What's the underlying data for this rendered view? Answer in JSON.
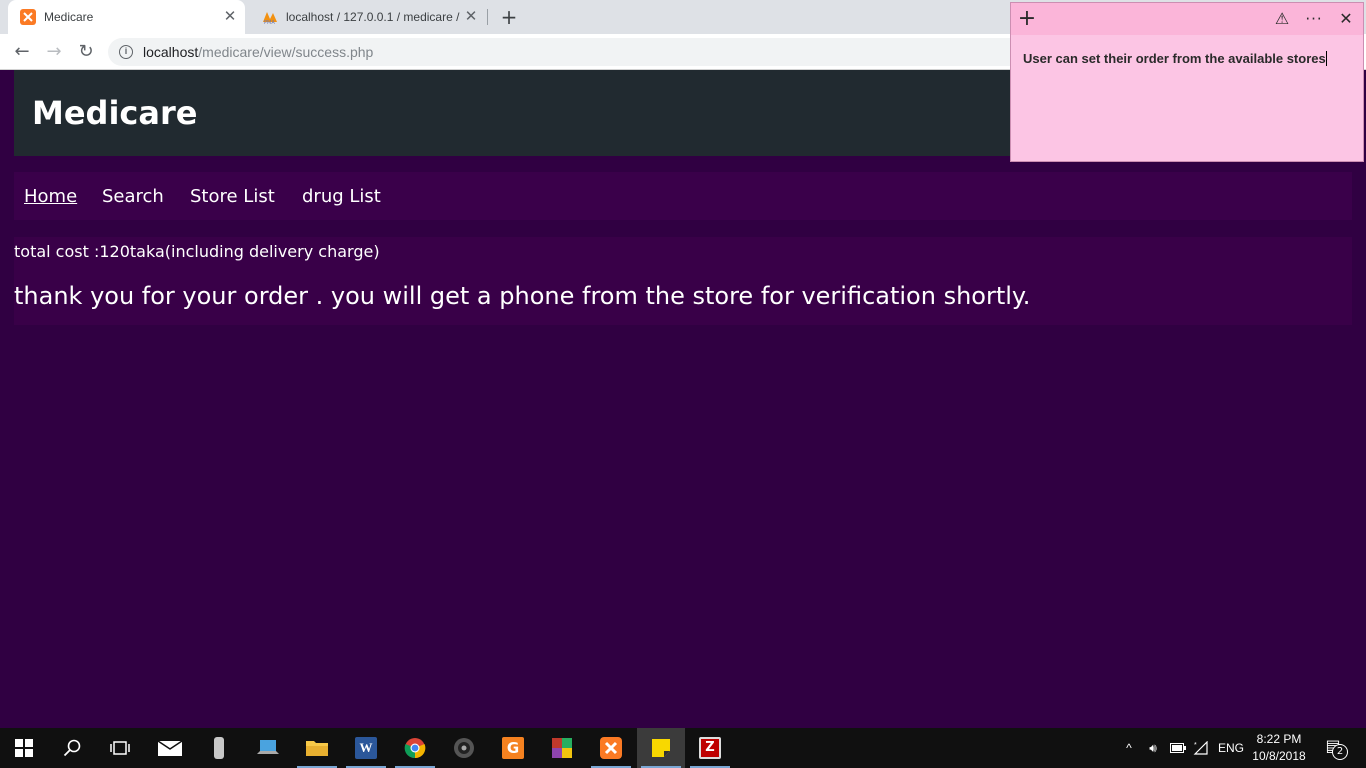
{
  "browser": {
    "tabs": [
      {
        "label": "Medicare",
        "icon": "xampp-icon",
        "active": true
      },
      {
        "label": "localhost / 127.0.0.1 / medicare /",
        "icon": "phpmyadmin-icon",
        "active": false
      }
    ],
    "address": {
      "host": "localhost",
      "path": "/medicare/view/success.php"
    }
  },
  "page": {
    "site_title": "Medicare",
    "nav": [
      {
        "label": "Home"
      },
      {
        "label": "Search"
      },
      {
        "label": "Store List"
      },
      {
        "label": "drug List"
      }
    ],
    "total_cost": "total cost :120taka(including delivery charge)",
    "thanks": "thank you for your order . you will get a phone from the store for verification shortly."
  },
  "sticky_note": {
    "text": "User can set their order from the available stores"
  },
  "taskbar": {
    "language": "ENG",
    "time": "8:22 PM",
    "date": "10/8/2018",
    "notifications": "2"
  },
  "colors": {
    "page_bg": "#300042",
    "header_bg": "#212a30",
    "nav_bg": "#3a004a",
    "sticky_bg": "#fcc5e4"
  }
}
